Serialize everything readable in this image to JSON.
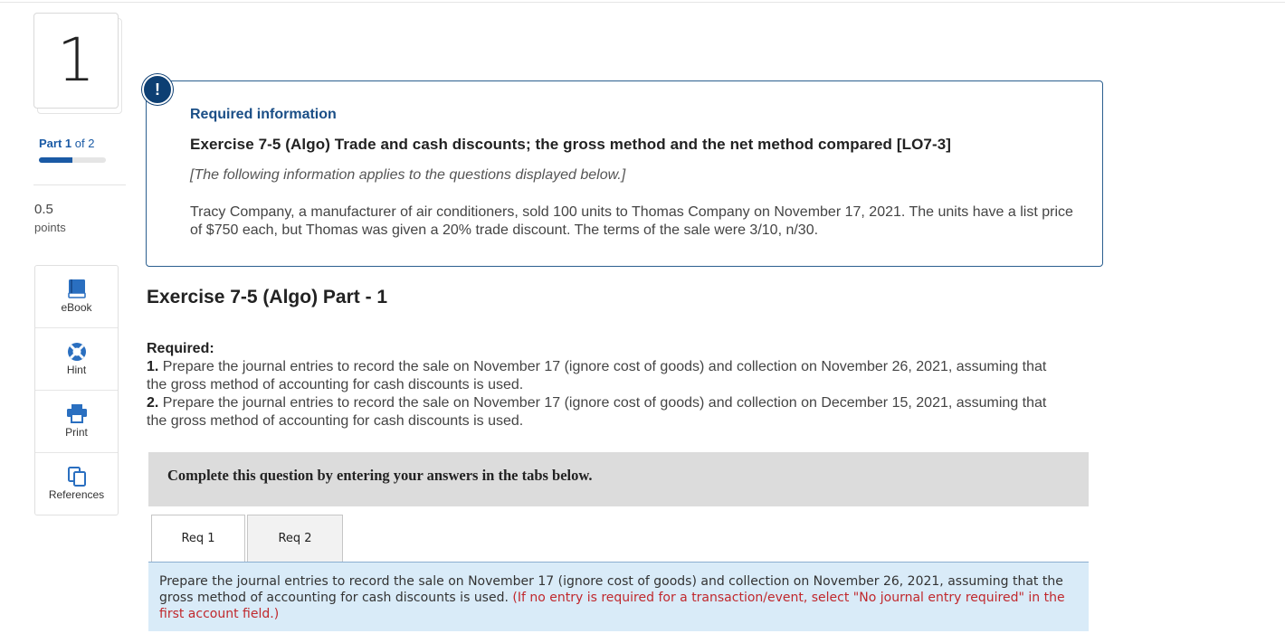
{
  "question": {
    "number": "1"
  },
  "part": {
    "label": "Part",
    "current": "1",
    "of_text": "of 2",
    "progress": 0.5
  },
  "points": {
    "value": "0.5",
    "label": "points"
  },
  "tools": [
    {
      "label": "eBook",
      "icon": "book-icon"
    },
    {
      "label": "Hint",
      "icon": "lifebuoy-icon"
    },
    {
      "label": "Print",
      "icon": "printer-icon"
    },
    {
      "label": "References",
      "icon": "copy-icon"
    }
  ],
  "info": {
    "badge": "!",
    "heading": "Required information",
    "title": "Exercise 7-5 (Algo) Trade and cash discounts; the gross method and the net method compared [LO7-3]",
    "note": "[The following information applies to the questions displayed below.]",
    "body": "Tracy Company, a manufacturer of air conditioners, sold 100 units to Thomas Company on November 17, 2021. The units have a list price of $750 each, but Thomas was given a 20% trade discount. The terms of the sale were 3/10, n/30."
  },
  "part_title": "Exercise 7-5 (Algo) Part - 1",
  "required": {
    "label": "Required:",
    "items": [
      {
        "num": "1.",
        "text": "Prepare the journal entries to record the sale on November 17 (ignore cost of goods) and collection on November 26, 2021, assuming that the gross method of accounting for cash discounts is used."
      },
      {
        "num": "2.",
        "text": "Prepare the journal entries to record the sale on November 17 (ignore cost of goods) and collection on December 15, 2021, assuming that the gross method of accounting for cash discounts is used."
      }
    ]
  },
  "complete_msg": "Complete this question by entering your answers in the tabs below.",
  "tabs": [
    {
      "label": "Req 1",
      "active": true
    },
    {
      "label": "Req 2",
      "active": false
    }
  ],
  "instructions": {
    "text": "Prepare the journal entries to record the sale on November 17 (ignore cost of goods) and collection on November 26, 2021, assuming that the gross method of accounting for cash discounts is used.",
    "note": "(If no entry is required for a transaction/event, select \"No journal entry required\" in the first account field.)"
  },
  "colors": {
    "accent": "#1a5aa5",
    "badge": "#0d3f73",
    "note_red": "#c0282d",
    "instr_bg": "#d9ebf8"
  }
}
